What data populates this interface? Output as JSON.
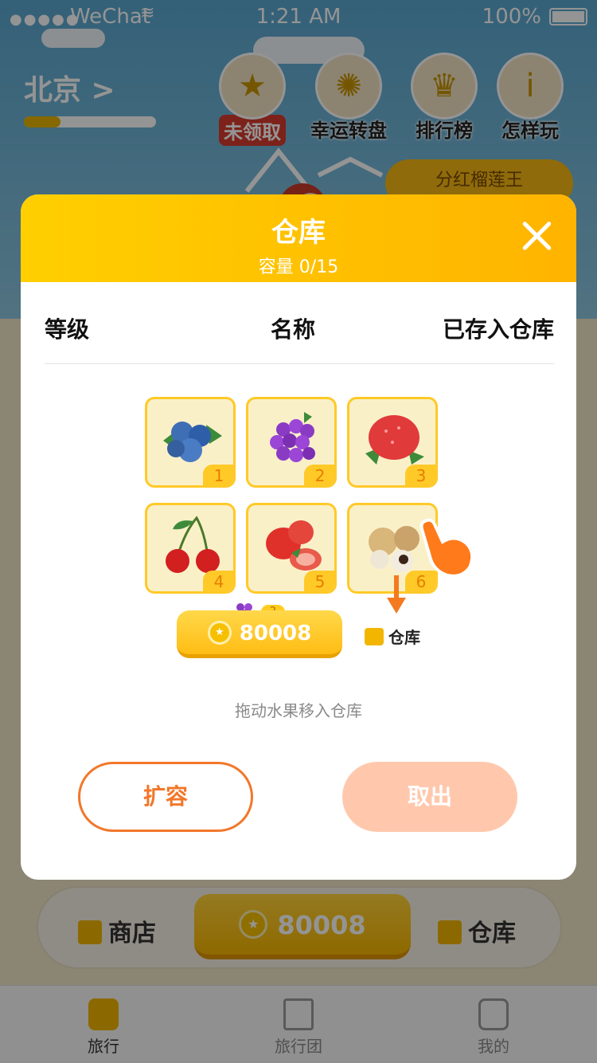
{
  "status_bar": {
    "carrier": "WeChat",
    "time": "1:21 AM",
    "battery": "100%"
  },
  "game": {
    "city": "北京 >",
    "progress_fraction": 0.28,
    "top_buttons": [
      {
        "icon": "coin-star-icon",
        "label": "未领取"
      },
      {
        "icon": "wheel-icon",
        "label": "幸运转盘"
      },
      {
        "icon": "trophy-icon",
        "label": "排行榜"
      },
      {
        "icon": "info-icon",
        "label": "怎样玩"
      }
    ],
    "dividend_label": "分红榴莲王",
    "shop_label": "商店",
    "store_label": "仓库",
    "coins": "80008",
    "fruit_badge_level": "2"
  },
  "tabs": [
    {
      "label": "旅行",
      "icon": "suitcase-icon",
      "active": true
    },
    {
      "label": "旅行团",
      "icon": "flag-icon",
      "active": false
    },
    {
      "label": "我的",
      "icon": "profile-icon",
      "active": false
    }
  ],
  "modal": {
    "title": "仓库",
    "capacity": "容量 0/15",
    "columns": [
      "等级",
      "名称",
      "已存入仓库"
    ],
    "fruits": [
      {
        "name": "blueberry-icon",
        "level": "1"
      },
      {
        "name": "grape-icon",
        "level": "2"
      },
      {
        "name": "strawberry-icon",
        "level": "3"
      },
      {
        "name": "cherry-icon",
        "level": "4"
      },
      {
        "name": "strawberry-pair-icon",
        "level": "5"
      },
      {
        "name": "longan-icon",
        "level": "6"
      }
    ],
    "coin_button": {
      "value": "80008",
      "badge": "2"
    },
    "store_link": "仓库",
    "hint": "拖动水果移入仓库",
    "expand_label": "扩容",
    "take_out_label": "取出"
  },
  "colors": {
    "accent": "#ffbf00",
    "orange": "#f2772a",
    "take_out": "#ffc8ad"
  }
}
